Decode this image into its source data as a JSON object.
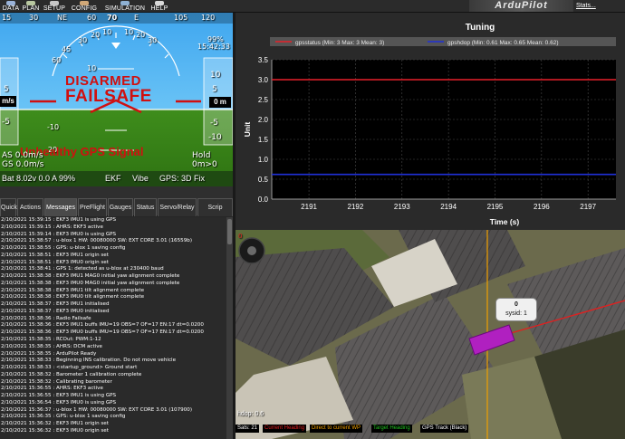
{
  "menu": {
    "items": [
      {
        "label": "DATA",
        "icon": "data-icon",
        "color": "#9ab3d8"
      },
      {
        "label": "PLAN",
        "icon": "plan-icon",
        "color": "#b8c7a0"
      },
      {
        "label": "SETUP",
        "icon": "setup-icon",
        "color": "#c8c8c8"
      },
      {
        "label": "CONFIG",
        "icon": "config-icon",
        "color": "#d0a878"
      },
      {
        "label": "SIMULATION",
        "icon": "simulation-icon",
        "color": "#8fb1d3"
      },
      {
        "label": "HELP",
        "icon": "help-icon",
        "color": "#d9d9d9"
      }
    ],
    "logo": "ArduPilot",
    "stats": "Stats..."
  },
  "hud": {
    "heading_labels": [
      "15",
      "30",
      "NE",
      "60",
      "75",
      "E",
      "105",
      "120"
    ],
    "heading_value": "70",
    "pitch_labels": [
      "10",
      "5",
      "-5",
      "-10"
    ],
    "roll_labels": [
      "30",
      "20",
      "10",
      "10",
      "20",
      "30",
      "45",
      "60"
    ],
    "disarmed": "DISARMED",
    "failsafe": "FAILSAFE",
    "gps_warning": "Unhealthy GPS Signal",
    "airspeed_unit": "m/s",
    "airspeed_ticks": [
      "10",
      "5",
      "-5"
    ],
    "altitude_value": "0 m",
    "altitude_ticks": [
      "10",
      "5",
      "-5",
      "-10"
    ],
    "speed_readout": "AS 0.0m/s",
    "ground_speed": "GS 0.0m/s",
    "mode": "Hold",
    "alt_small": "0m>0",
    "time": "15:42:33",
    "percent": "99%",
    "battery": "Bat 8.02v 0.0 A 99%",
    "ekf": "EKF",
    "vibe": "Vibe",
    "gps_fix": "GPS: 3D Fix",
    "pitch_center_ticks": [
      "-20",
      "-10",
      "10"
    ]
  },
  "tabs": [
    {
      "label": "Quick",
      "active": false
    },
    {
      "label": "Actions",
      "active": false
    },
    {
      "label": "Messages",
      "active": true
    },
    {
      "label": "PreFlight",
      "active": false
    },
    {
      "label": "Gauges",
      "active": false
    },
    {
      "label": "Status",
      "active": false
    },
    {
      "label": "Servo/Relay",
      "active": false
    },
    {
      "label": "Scrip",
      "active": false
    }
  ],
  "messages": [
    "2/10/2021 15:39:15 : EKF3 IMU1 is using GPS",
    "2/10/2021 15:39:15 : AHRS: EKF3 active",
    "2/10/2021 15:39:14 : EKF3 IMU0 is using GPS",
    "2/10/2021 15:38:57 : u-blox 1 HW: 00080000 SW: EXT CORE 3.01 (16559b)",
    "2/10/2021 15:38:55 : GPS: u-blox 1 saving config",
    "2/10/2021 15:38:51 : EKF3 IMU1 origin set",
    "2/10/2021 15:38:51 : EKF3 IMU0 origin set",
    "2/10/2021 15:38:41 : GPS 1: detected as u-blox at 230400 baud",
    "2/10/2021 15:38:38 : EKF3 IMU1 MAG0 initial yaw alignment complete",
    "2/10/2021 15:38:38 : EKF3 IMU0 MAG0 initial yaw alignment complete",
    "2/10/2021 15:38:38 : EKF3 IMU1 tilt alignment complete",
    "2/10/2021 15:38:38 : EKF3 IMU0 tilt alignment complete",
    "2/10/2021 15:38:37 : EKF3 IMU1 initialised",
    "2/10/2021 15:38:37 : EKF3 IMU0 initialised",
    "2/10/2021 15:38:36 : Radio Failsafe",
    "2/10/2021 15:38:36 : EKF3 IMU1 buffs IMU=19 OBS=7 OF=17 EN:17 dt=0.0200",
    "2/10/2021 15:38:36 : EKF3 IMU0 buffs IMU=19 OBS=7 OF=17 EN:17 dt=0.0200",
    "2/10/2021 15:38:35 : RCOut: PWM:1-12",
    "2/10/2021 15:38:35 : AHRS: DCM active",
    "2/10/2021 15:38:35 : ArduPilot Ready",
    "2/10/2021 15:38:33 : Beginning INS calibration. Do not move vehicle",
    "2/10/2021 15:38:33 : <startup_ground> Ground start",
    "2/10/2021 15:38:32 : Barometer 1 calibration complete",
    "2/10/2021 15:38:32 : Calibrating barometer",
    "2/10/2021 15:36:55 : AHRS: EKF3 active",
    "2/10/2021 15:36:55 : EKF3 IMU1 is using GPS",
    "2/10/2021 15:36:54 : EKF3 IMU0 is using GPS",
    "2/10/2021 15:36:37 : u-blox 1 HW: 00080000 SW: EXT CORE 3.01 (107900)",
    "2/10/2021 15:36:35 : GPS: u-blox 1 saving config",
    "2/10/2021 15:36:32 : EKF3 IMU1 origin set",
    "2/10/2021 15:36:32 : EKF3 IMU0 origin set"
  ],
  "chart_data": {
    "type": "line",
    "title": "Tuning",
    "xlabel": "Time (s)",
    "ylabel": "Unit",
    "xlim": [
      2190.2,
      2197.6
    ],
    "ylim": [
      0,
      3.5
    ],
    "x_ticks": [
      2191,
      2192,
      2193,
      2194,
      2195,
      2196,
      2197
    ],
    "y_ticks": [
      0.0,
      0.5,
      1.0,
      1.5,
      2.0,
      2.5,
      3.0,
      3.5
    ],
    "grid": true,
    "legend_placement": "top",
    "series": [
      {
        "name": "gpsstatus (Min: 3 Max: 3 Mean: 3)",
        "color": "#e8202a",
        "x": [
          2190.2,
          2197.6
        ],
        "y": [
          3.0,
          3.0
        ]
      },
      {
        "name": "gpshdop (Min: 0.61 Max: 0.65 Mean: 0.62)",
        "color": "#2030d8",
        "x": [
          2190.2,
          2197.6
        ],
        "y": [
          0.62,
          0.62
        ]
      }
    ]
  },
  "map": {
    "hdop": "hdop: 0.6",
    "uav_label": "0",
    "uav_sysid": "sysid: 1",
    "legend": [
      {
        "label": "Sats: 21",
        "color": "#ffffff"
      },
      {
        "label": "Current Heading",
        "color": "#e02020"
      },
      {
        "label": "Direct to current WP",
        "color": "#f0a000"
      },
      {
        "label": "Target Heading",
        "color": "#20c020"
      },
      {
        "label": "GPS Track (Black)",
        "color": "#ffffff"
      }
    ],
    "zoom_indicator": "0"
  }
}
